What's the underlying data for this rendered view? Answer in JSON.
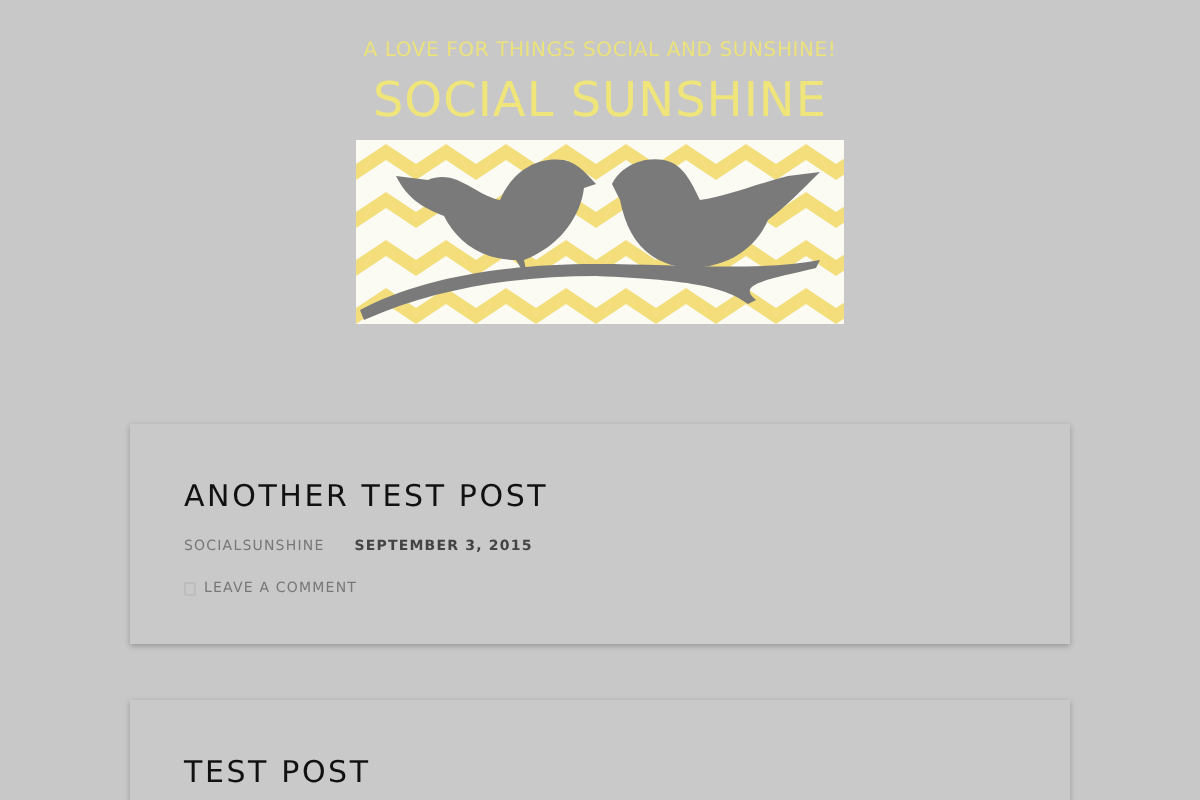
{
  "site": {
    "tagline": "A LOVE FOR THINGS SOCIAL AND SUNSHINE!",
    "title": "SOCIAL SUNSHINE"
  },
  "posts": [
    {
      "title": "ANOTHER TEST POST",
      "author": "SOCIALSUNSHINE",
      "date": "SEPTEMBER 3, 2015",
      "comments": "LEAVE A COMMENT"
    },
    {
      "title": "TEST POST"
    }
  ]
}
